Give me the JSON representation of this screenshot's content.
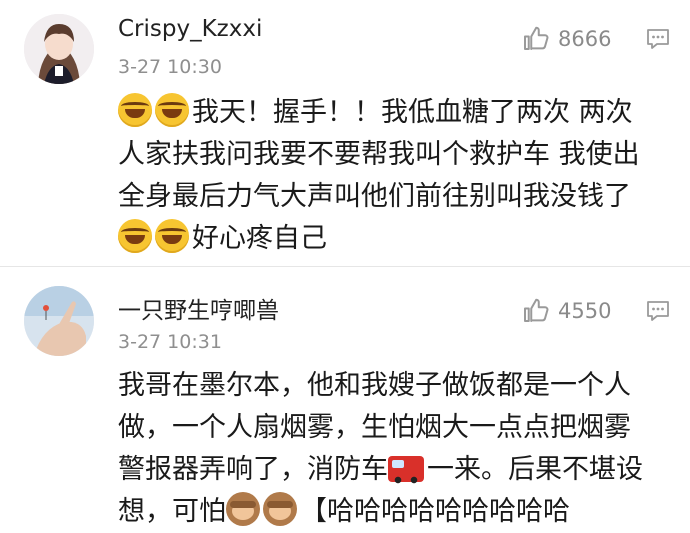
{
  "comments": [
    {
      "username": "Crispy_Kzxxi",
      "time": "3-27 10:30",
      "likes": "8666",
      "icons": {
        "avatar": "avatar-girl",
        "like": "thumbs-up-icon",
        "reply": "comment-icon"
      },
      "lines": [
        {
          "pre_emojis": [
            "laugh-cry",
            "laugh-cry"
          ],
          "text": "我天！握手！！我低血糖了两次 两次"
        },
        {
          "text": "人家扶我问我要不要帮我叫个救护车 我使出"
        },
        {
          "text": "全身最后力气大声叫他们前往别叫我没钱了"
        },
        {
          "pre_emojis": [
            "laugh-cry",
            "laugh-cry"
          ],
          "text": "好心疼自己"
        }
      ]
    },
    {
      "username": "一只野生哼唧兽",
      "time": "3-27 10:31",
      "likes": "4550",
      "icons": {
        "avatar": "avatar-hand",
        "like": "thumbs-up-icon",
        "reply": "comment-icon"
      },
      "lines": [
        {
          "text": "我哥在墨尔本，他和我嫂子做饭都是一个人"
        },
        {
          "text": "做，一个人扇烟雾，生怕烟大一点点把烟雾"
        },
        {
          "text_a": "警报器弄响了，消防车",
          "mid_emoji": "fire-engine",
          "text_b": "一来。后果不堪设"
        },
        {
          "text_a": "想，可怕",
          "mid_emojis": [
            "see-no-evil-monkey",
            "see-no-evil-monkey"
          ],
          "text_b": "【哈哈哈哈哈哈哈哈哈"
        }
      ]
    }
  ]
}
